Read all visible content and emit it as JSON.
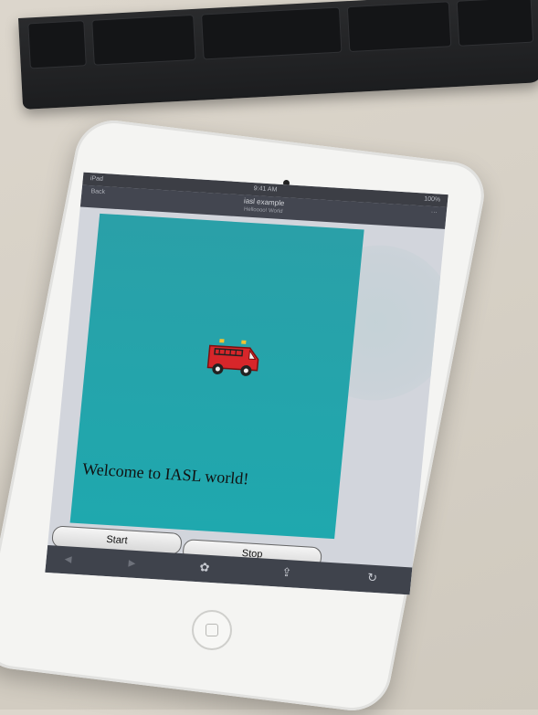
{
  "status_bar": {
    "left": "iPad",
    "center": "9:41 AM",
    "right": "100%"
  },
  "nav": {
    "left": "Back",
    "title": "iasl example",
    "subtitle": "Helloooo! World",
    "right": "···"
  },
  "app": {
    "welcome_text": "Welcome to IASL world!",
    "start_label": "Start",
    "stop_label": "Stop",
    "canvas_color": "#23a5ab"
  },
  "toolbar": {
    "back_icon": "◀",
    "forward_icon": "▶",
    "share_icon": "⇪",
    "refresh_icon": "↻",
    "tools_icon": "✿"
  },
  "icons": {
    "firetruck": "fire-truck-icon",
    "back": "back-arrow-icon",
    "forward": "forward-arrow-icon",
    "tools": "tools-icon",
    "share": "share-icon",
    "refresh": "refresh-icon"
  }
}
